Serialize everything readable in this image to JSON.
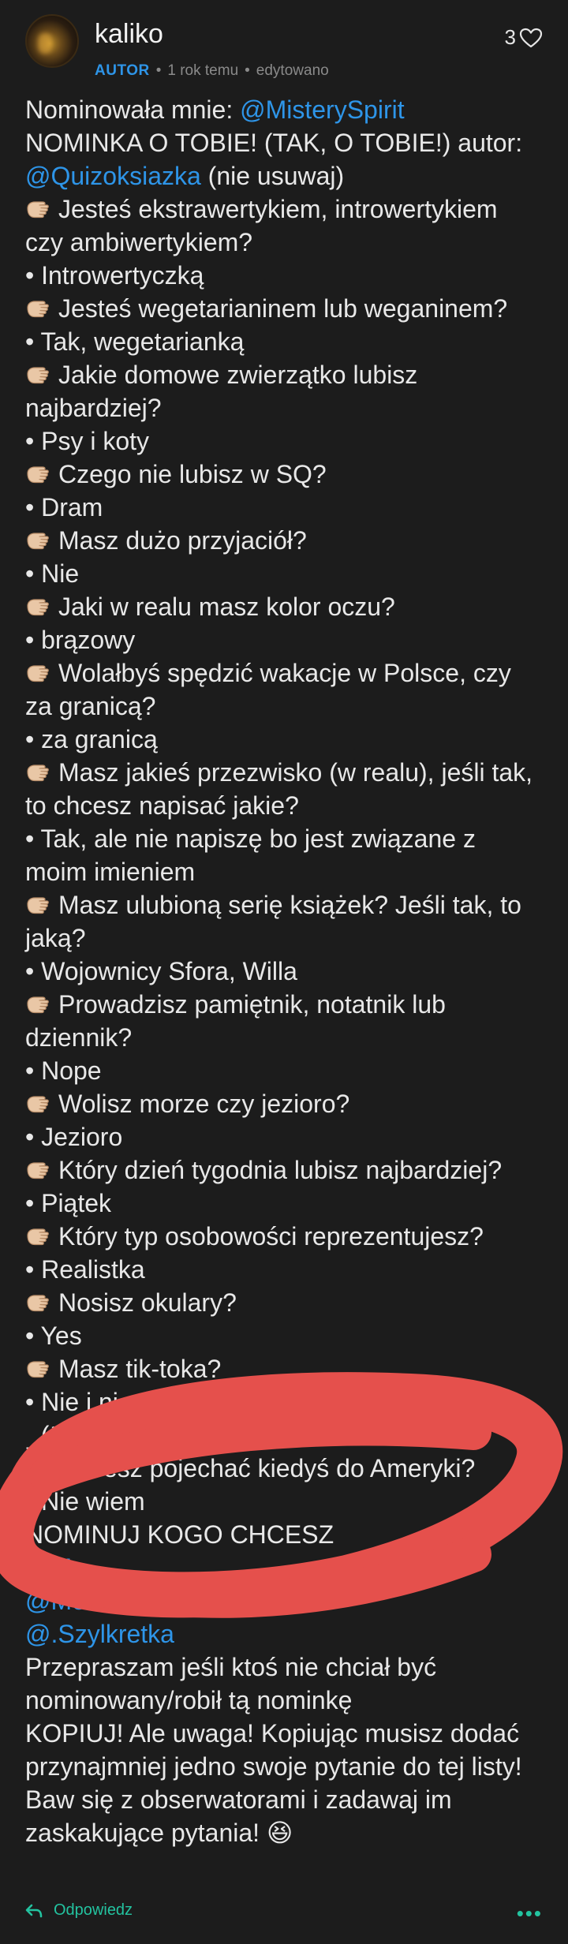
{
  "comment": {
    "author": "kaliko",
    "badge": "AUTOR",
    "time": "1 rok temu",
    "edited": "edytowano",
    "likes": "3"
  },
  "content": {
    "nominated_by_prefix": "Nominowała mnie: ",
    "nominated_by_mention": "@MisterySpirit",
    "title_line": "NOMINKA O TOBIE! (TAK, O TOBIE!) autor:",
    "author_mention": "@Quizoksiazka",
    "author_suffix": " (nie usuwaj)",
    "qa": [
      {
        "q": "Jesteś ekstrawertykiem, introwertykiem czy ambiwertykiem?",
        "a": "• Introwertyczką"
      },
      {
        "q": "Jesteś wegetarianinem lub weganinem?",
        "a": "• Tak, wegetarianką"
      },
      {
        "q": "Jakie domowe zwierzątko lubisz najbardziej?",
        "a": "• Psy i koty"
      },
      {
        "q": "Czego nie lubisz w SQ?",
        "a": "• Dram"
      },
      {
        "q": "Masz dużo przyjaciół?",
        "a": "• Nie"
      },
      {
        "q": "Jaki w realu masz kolor oczu?",
        "a": "• brązowy"
      },
      {
        "q": "Wolałbyś spędzić wakacje w Polsce, czy za granicą?",
        "a": "• za granicą"
      },
      {
        "q": "Masz jakieś przezwisko (w realu), jeśli tak, to chcesz napisać jakie?",
        "a": "• Tak, ale nie napiszę bo jest związane z moim imieniem"
      },
      {
        "q": "Masz ulubioną serię książek? Jeśli tak, to jaką?",
        "a": "• Wojownicy Sfora, Willa"
      },
      {
        "q": "Prowadzisz pamiętnik, notatnik lub dziennik?",
        "a": "• Nope"
      },
      {
        "q": "Wolisz morze czy jezioro?",
        "a": "• Jezioro"
      },
      {
        "q": "Który dzień tygodnia lubisz najbardziej?",
        "a": "• Piątek"
      },
      {
        "q": "Który typ osobowości reprezentujesz?",
        "a": "• Realistka"
      },
      {
        "q": "Nosisz okulary?",
        "a": "• Yes"
      },
      {
        "q": "Masz tik-toka?",
        "a": "• Nie i ni"
      }
    ],
    "shrug": "_(ツ)_/",
    "last_q": "Chcesz pojechać kiedyś do Ameryki?",
    "last_a": "• Nie wiem",
    "nominate_line": "NOMINUJ KOGO CHCESZ",
    "mentions_end": [
      "@M",
      "@MoonCloud.",
      "@.Szylkretka"
    ],
    "closing": [
      "Przepraszam jeśli ktoś nie chciał być nominowany/robił tą nominkę",
      "KOPIUJ! Ale uwaga! Kopiując musisz dodać przynajmniej jedno swoje pytanie do tej listy! Baw się z obserwatorami i zadawaj im zaskakujące pytania! 😆"
    ]
  },
  "footer": {
    "reply_label": "Odpowiedz",
    "more": "•••"
  },
  "colors": {
    "background": "#1c1c1c",
    "mention": "#2e95e8",
    "accent": "#23c3a0",
    "scribble": "#e5504c"
  }
}
